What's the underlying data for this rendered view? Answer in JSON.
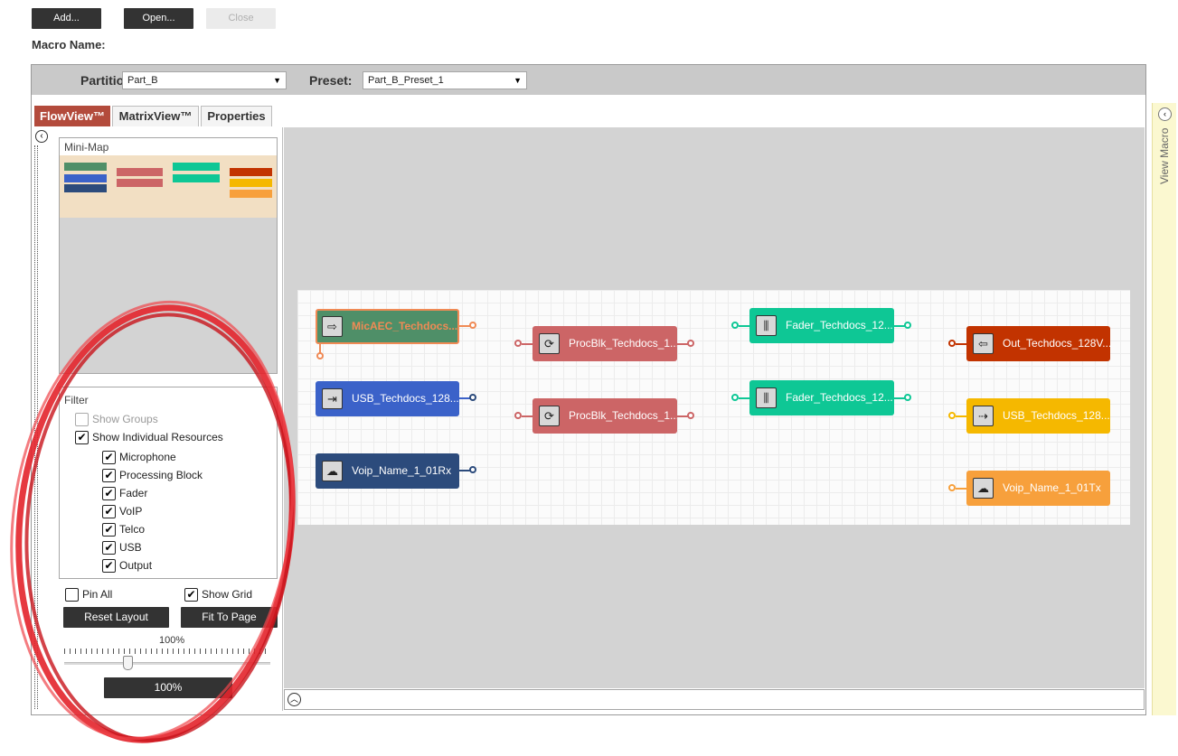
{
  "toolbar": {
    "add_label": "Add...",
    "open_label": "Open...",
    "close_label": "Close"
  },
  "macro_name_label": "Macro Name:",
  "partition": {
    "label": "Partition:",
    "value": "Part_B",
    "preset_label": "Preset:",
    "preset_value": "Part_B_Preset_1"
  },
  "tabs": [
    {
      "label": "FlowView™"
    },
    {
      "label": "MatrixView™"
    },
    {
      "label": "Properties"
    }
  ],
  "left_panel": {
    "mini_map_title": "Mini-Map",
    "filter": {
      "title": "Filter",
      "items": [
        {
          "label": "Show Groups",
          "checked": false,
          "disabled": true
        },
        {
          "label": "Show Individual Resources",
          "checked": true
        },
        {
          "label": "Microphone",
          "checked": true
        },
        {
          "label": "Processing Block",
          "checked": true
        },
        {
          "label": "Fader",
          "checked": true
        },
        {
          "label": "VoIP",
          "checked": true
        },
        {
          "label": "Telco",
          "checked": true
        },
        {
          "label": "USB",
          "checked": true
        },
        {
          "label": "Output",
          "checked": true
        }
      ]
    },
    "pin_all": {
      "label": "Pin All",
      "checked": false
    },
    "show_grid": {
      "label": "Show Grid",
      "checked": true
    },
    "reset_layout_label": "Reset Layout",
    "fit_to_page_label": "Fit To Page",
    "zoom_label": "100%",
    "zoom_value_button": "100%",
    "zoom_level": 0.3
  },
  "nodes": [
    {
      "label": "MicAEC_Techdocs...",
      "color": "#4f8f68",
      "text_color": "#f08a55",
      "icon": "mic-input-icon"
    },
    {
      "label": "USB_Techdocs_128...",
      "color": "#3b62c9",
      "icon": "usb-input-icon"
    },
    {
      "label": "Voip_Name_1_01Rx",
      "color": "#2c4b7c",
      "icon": "voip-rx-icon"
    },
    {
      "label": "ProcBlk_Techdocs_1...",
      "color": "#cc6566",
      "icon": "processing-icon"
    },
    {
      "label": "ProcBlk_Techdocs_1...",
      "color": "#cc6566",
      "icon": "processing-icon"
    },
    {
      "label": "Fader_Techdocs_12...",
      "color": "#0ec795",
      "icon": "fader-icon"
    },
    {
      "label": "Fader_Techdocs_12...",
      "color": "#0ec795",
      "icon": "fader-icon"
    },
    {
      "label": "Out_Techdocs_128V...",
      "color": "#c23300",
      "icon": "output-icon"
    },
    {
      "label": "USB_Techdocs_128...",
      "color": "#f5b800",
      "icon": "usb-output-icon"
    },
    {
      "label": "Voip_Name_1_01Tx",
      "color": "#f7a03c",
      "icon": "voip-tx-icon"
    }
  ],
  "side_panel": {
    "label": "View Macro"
  },
  "colors": {
    "accent_tab": "#b34b3c",
    "annotation": "#e3242b"
  }
}
